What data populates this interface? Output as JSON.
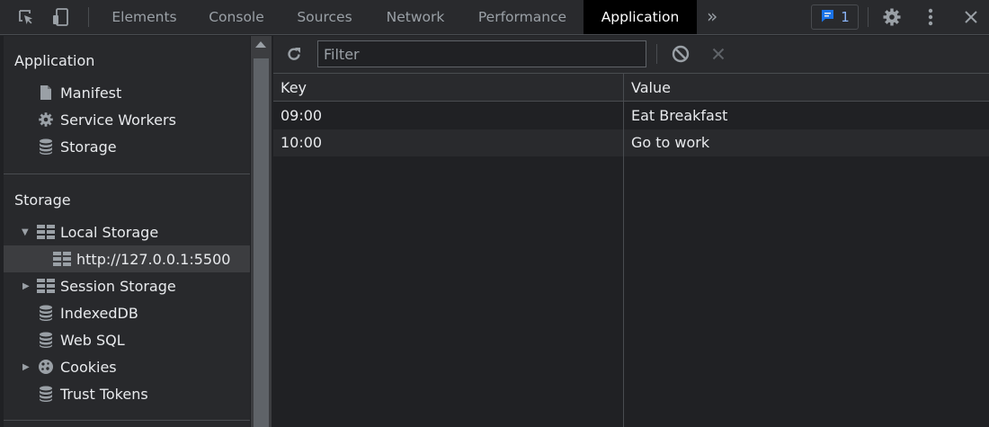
{
  "toolbar": {
    "tabs": [
      {
        "label": "Elements",
        "active": false
      },
      {
        "label": "Console",
        "active": false
      },
      {
        "label": "Sources",
        "active": false
      },
      {
        "label": "Network",
        "active": false
      },
      {
        "label": "Performance",
        "active": false
      },
      {
        "label": "Application",
        "active": true
      }
    ],
    "more_label": "»",
    "issues_count": "1",
    "icons": [
      "inspect-element-icon",
      "device-toggle-icon",
      "issues-chat-icon",
      "gear-icon",
      "kebab-menu-icon",
      "close-icon"
    ]
  },
  "sidebar": {
    "application_title": "Application",
    "application_items": [
      {
        "label": "Manifest",
        "icon": "file-icon"
      },
      {
        "label": "Service Workers",
        "icon": "gear-icon"
      },
      {
        "label": "Storage",
        "icon": "database-icon"
      }
    ],
    "storage_title": "Storage",
    "storage_items": [
      {
        "label": "Local Storage",
        "icon": "grid-icon",
        "expanded": true
      },
      {
        "label": "http://127.0.0.1:5500",
        "icon": "grid-icon",
        "selected": true
      },
      {
        "label": "Session Storage",
        "icon": "grid-icon",
        "expanded": false
      },
      {
        "label": "IndexedDB",
        "icon": "database-icon"
      },
      {
        "label": "Web SQL",
        "icon": "database-icon"
      },
      {
        "label": "Cookies",
        "icon": "cookie-icon",
        "expanded": false
      },
      {
        "label": "Trust Tokens",
        "icon": "database-icon"
      }
    ]
  },
  "main": {
    "filter": {
      "placeholder": "Filter",
      "value": ""
    },
    "icons": [
      "refresh-icon",
      "clear-all-icon",
      "delete-selected-icon"
    ],
    "table": {
      "columns": [
        "Key",
        "Value"
      ],
      "rows": [
        {
          "key": "09:00",
          "value": "Eat Breakfast"
        },
        {
          "key": "10:00",
          "value": "Go to work"
        }
      ]
    }
  },
  "colors": {
    "background": "#202124",
    "toolbar": "#292a2d",
    "active_tab": "#000000",
    "accent": "#8ab4f8",
    "text": "#e8eaed",
    "muted": "#9aa0a6"
  }
}
